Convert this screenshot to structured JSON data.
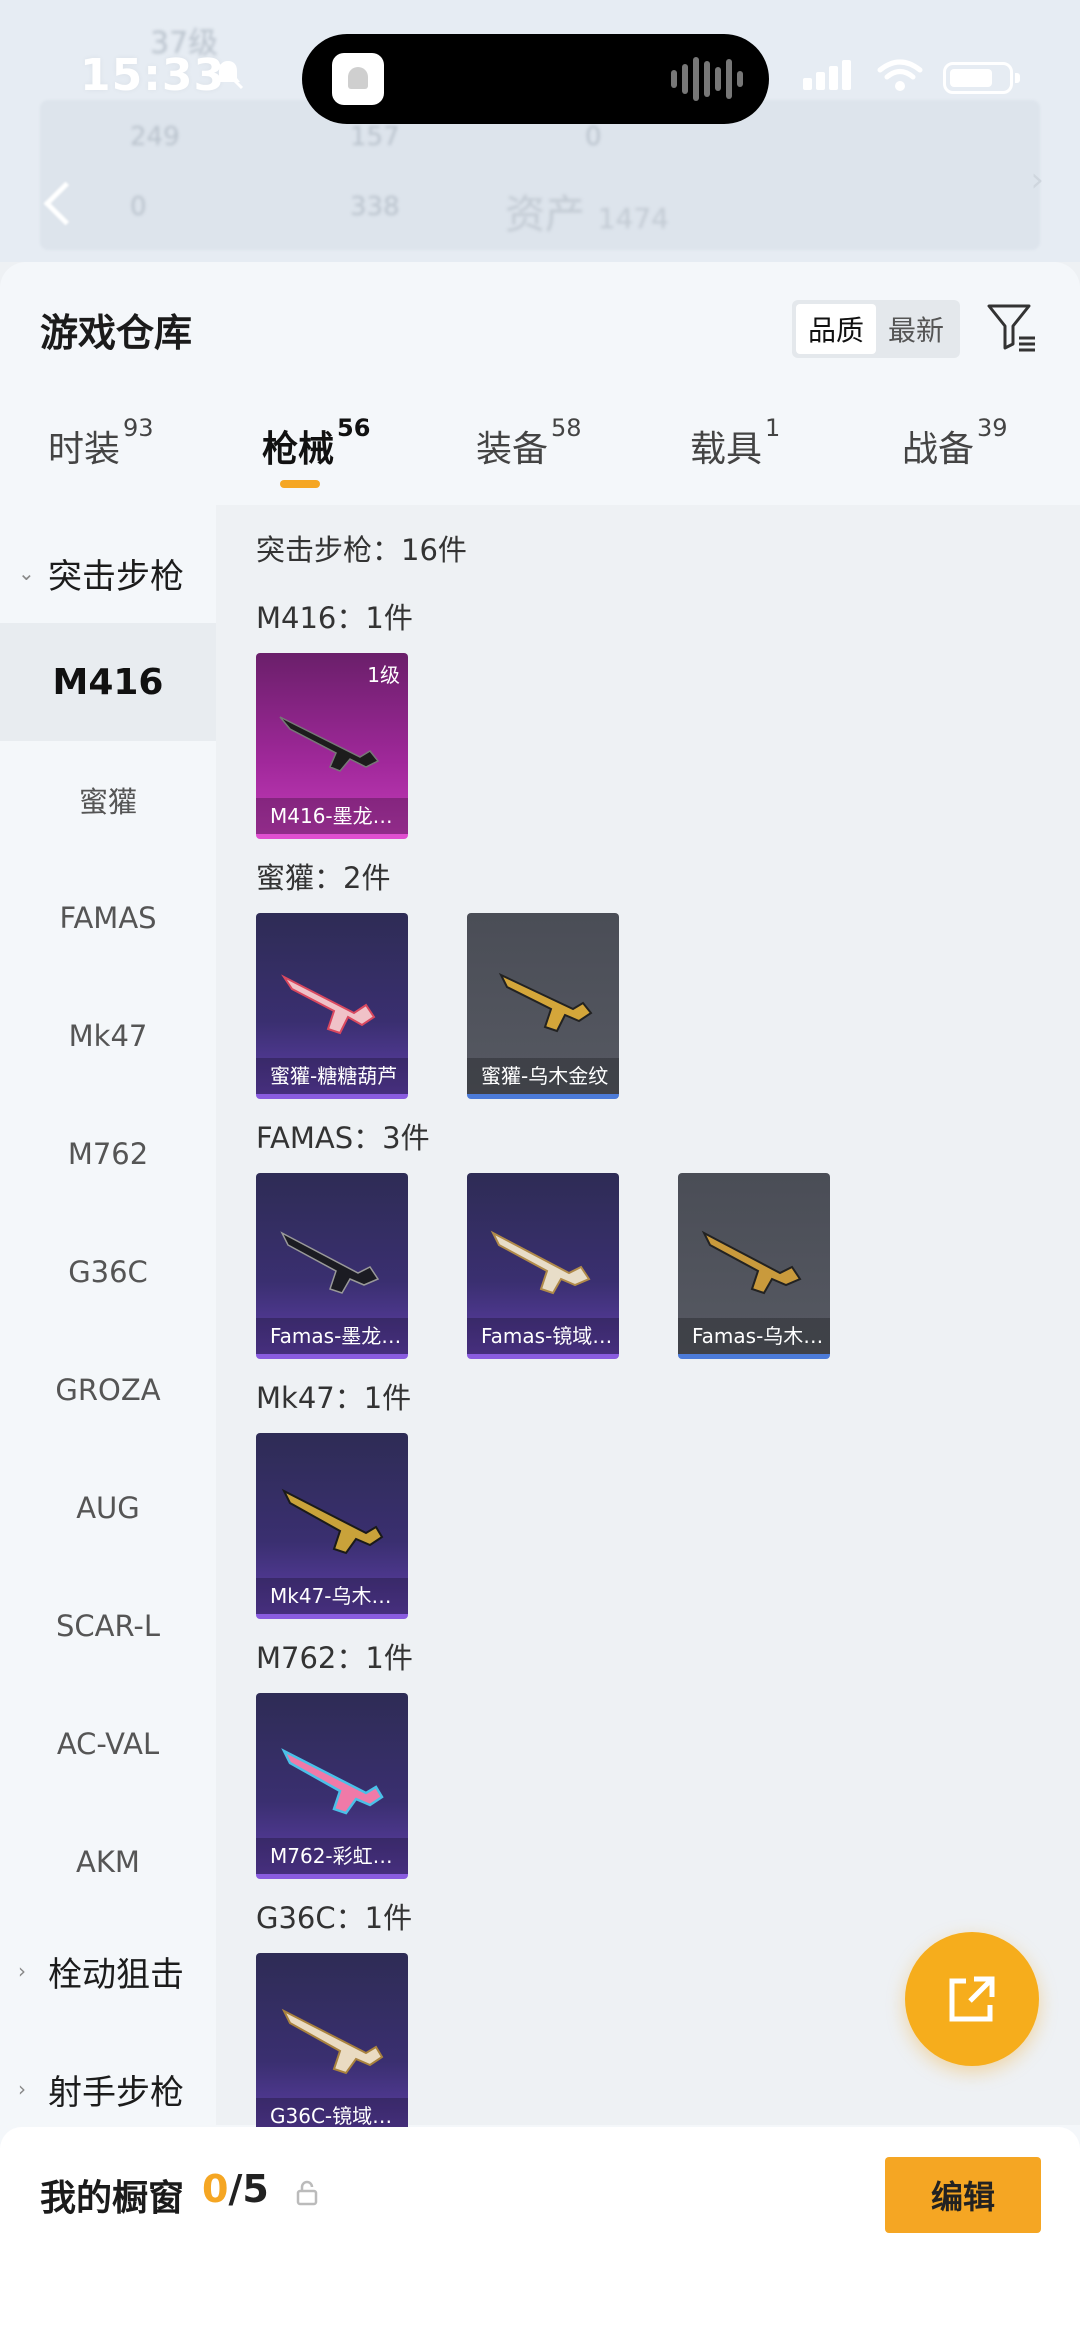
{
  "status_bar": {
    "time": "15:33"
  },
  "background": {
    "level": "37级",
    "stats_row1": [
      "249",
      "157",
      "0"
    ],
    "stats_row2": [
      "0",
      "338"
    ],
    "asset_label": "资产",
    "asset_value": "1474"
  },
  "header": {
    "title": "游戏仓库",
    "sort_options": [
      "品质",
      "最新"
    ]
  },
  "tabs": [
    {
      "label": "时装",
      "count": "93"
    },
    {
      "label": "枪械",
      "count": "56"
    },
    {
      "label": "装备",
      "count": "58"
    },
    {
      "label": "载具",
      "count": "1"
    },
    {
      "label": "战备",
      "count": "39"
    }
  ],
  "sidebar": {
    "group_open": "突击步枪",
    "items": [
      "M416",
      "蜜獾",
      "FAMAS",
      "Mk47",
      "M762",
      "G36C",
      "GROZA",
      "AUG",
      "SCAR-L",
      "AC-VAL",
      "AKM"
    ],
    "group_closed_1": "栓动狙击",
    "group_closed_2": "射手步枪"
  },
  "content": {
    "summary": "突击步枪：16件",
    "sections": [
      {
        "heading": "M416：1件",
        "cards": [
          {
            "name": "M416-墨龙…",
            "level": "1级"
          }
        ]
      },
      {
        "heading": "蜜獾：2件",
        "cards": [
          {
            "name": "蜜獾-糖糖葫芦"
          },
          {
            "name": "蜜獾-乌木金纹"
          }
        ]
      },
      {
        "heading": "FAMAS：3件",
        "cards": [
          {
            "name": "Famas-墨龙…"
          },
          {
            "name": "Famas-镜域…"
          },
          {
            "name": "Famas-乌木…"
          }
        ]
      },
      {
        "heading": "Mk47：1件",
        "cards": [
          {
            "name": "Mk47-乌木…"
          }
        ]
      },
      {
        "heading": "M762：1件",
        "cards": [
          {
            "name": "M762-彩虹…"
          }
        ]
      },
      {
        "heading": "G36C：1件",
        "cards": [
          {
            "name": "G36C-镜域…"
          }
        ]
      }
    ]
  },
  "showcase": {
    "title": "我的橱窗",
    "current": "0",
    "total": "/5",
    "edit_label": "编辑"
  },
  "colors": {
    "accent": "#f5a623"
  }
}
